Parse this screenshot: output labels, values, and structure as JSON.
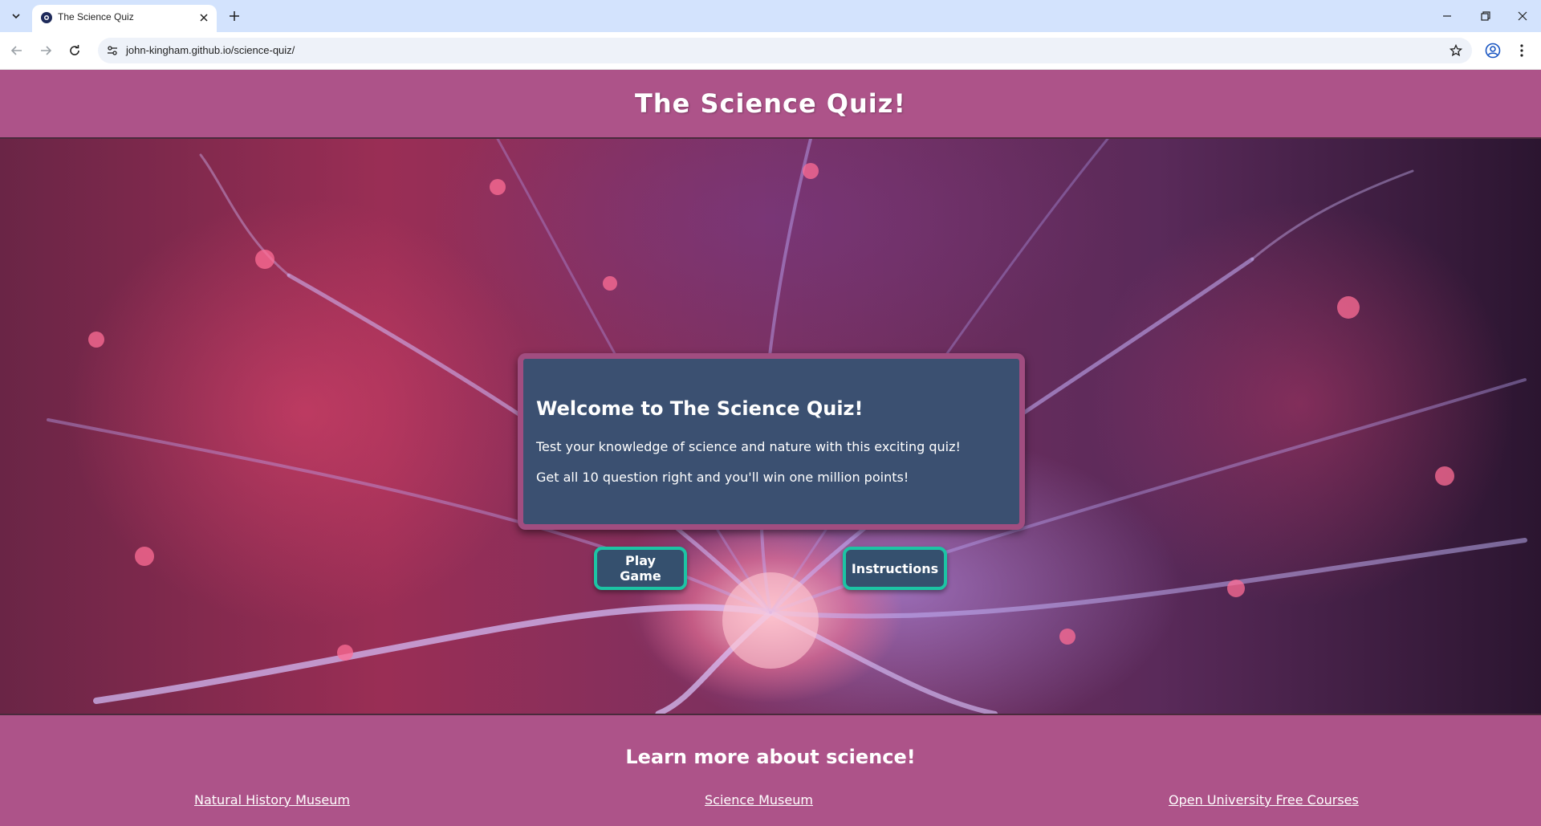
{
  "browser": {
    "tab_title": "The Science Quiz",
    "url": "john-kingham.github.io/science-quiz/"
  },
  "header": {
    "title": "The Science Quiz!"
  },
  "welcome": {
    "heading": "Welcome to The Science Quiz!",
    "line1": "Test your knowledge of science and nature with this exciting quiz!",
    "line2": "Get all 10 question right and you'll win one million points!"
  },
  "buttons": {
    "play": "Play Game",
    "instructions": "Instructions"
  },
  "footer": {
    "heading": "Learn more about science!",
    "links": [
      "Natural History Museum",
      "Science Museum",
      "Open University Free Courses"
    ]
  },
  "colors": {
    "header_bg": "#ad5389",
    "card_bg": "#3b5071",
    "card_border": "#a14d80",
    "button_border": "#1cc4a4",
    "tabstrip_bg": "#d3e3fd"
  },
  "icons": [
    "tab-search-icon",
    "site-favicon-icon",
    "close-icon",
    "plus-icon",
    "minimize-icon",
    "restore-icon",
    "window-close-icon",
    "back-icon",
    "forward-icon",
    "reload-icon",
    "site-info-icon",
    "star-icon",
    "profile-icon",
    "more-menu-icon"
  ]
}
